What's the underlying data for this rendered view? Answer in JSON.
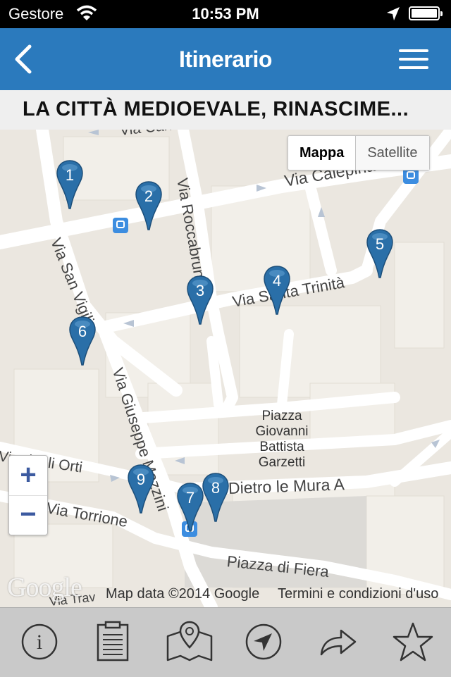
{
  "status_bar": {
    "carrier": "Gestore",
    "time": "10:53 PM"
  },
  "nav": {
    "title": "Itinerario"
  },
  "subtitle": "LA CITTÀ MEDIOEVALE, RINASCIME...",
  "map": {
    "type_buttons": {
      "map": "Mappa",
      "satellite": "Satellite"
    },
    "zoom": {
      "in": "+",
      "out": "−"
    },
    "streets": {
      "carlo_dora": "Via Carlo Dora",
      "calepina": "Via Calepina",
      "roccabruna": "Via Roccabruna",
      "san_vigilio": "Via San Vigilio",
      "santa_trinita": "Via Santa Trinità",
      "mazzini": "Via Giuseppe Mazzini",
      "orti": "Via degli Orti",
      "dietro": "Dietro le Mura A",
      "torrione": "Via Torrione",
      "fiera": "Piazza di Fiera",
      "trav": "Via Trav"
    },
    "place": {
      "line1": "Piazza",
      "line2": "Giovanni",
      "line3": "Battista",
      "line4": "Garzetti"
    },
    "pins": [
      "1",
      "2",
      "3",
      "4",
      "5",
      "6",
      "7",
      "8",
      "9"
    ],
    "logo": "Google",
    "attribution": "Map data ©2014 Google",
    "terms": "Termini e condizioni d'uso"
  },
  "tab_bar": {
    "icons": [
      "info-icon",
      "clipboard-icon",
      "map-pin-icon",
      "navigation-icon",
      "share-icon",
      "star-icon"
    ]
  },
  "colors": {
    "nav_blue": "#2b7abd",
    "pin_blue": "#2a6fa8"
  }
}
